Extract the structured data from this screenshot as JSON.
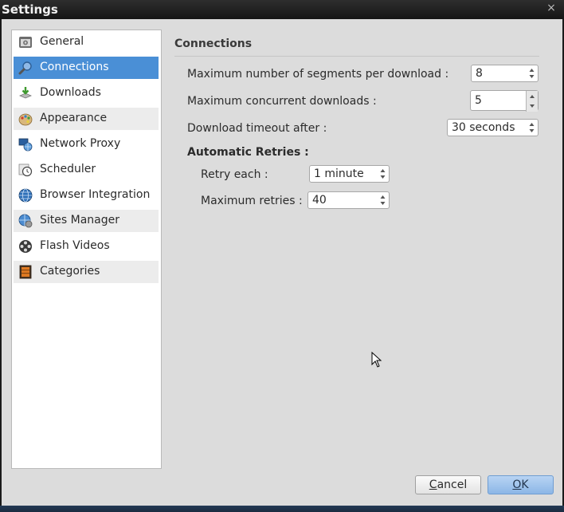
{
  "window": {
    "title": "Settings",
    "close_glyph": "×"
  },
  "sidebar": {
    "items": [
      {
        "label": "General",
        "icon": "general-icon"
      },
      {
        "label": "Connections",
        "icon": "connections-icon",
        "selected": true
      },
      {
        "label": "Downloads",
        "icon": "downloads-icon"
      },
      {
        "label": "Appearance",
        "icon": "appearance-icon"
      },
      {
        "label": "Network Proxy",
        "icon": "network-proxy-icon"
      },
      {
        "label": "Scheduler",
        "icon": "scheduler-icon"
      },
      {
        "label": "Browser Integration",
        "icon": "browser-integration-icon"
      },
      {
        "label": "Sites Manager",
        "icon": "sites-manager-icon"
      },
      {
        "label": "Flash Videos",
        "icon": "flash-videos-icon"
      },
      {
        "label": "Categories",
        "icon": "categories-icon"
      }
    ]
  },
  "connections": {
    "title": "Connections",
    "max_segments": {
      "label": "Maximum number of segments per download :",
      "value": "8"
    },
    "max_concurrent": {
      "label": "Maximum concurrent downloads :",
      "value": "5"
    },
    "timeout": {
      "label": "Download timeout after :",
      "value": "30 seconds"
    },
    "retries": {
      "title": "Automatic Retries :",
      "retry_each": {
        "label": "Retry each :",
        "value": "1 minute"
      },
      "max_retries": {
        "label": "Maximum retries :",
        "value": "40"
      }
    }
  },
  "buttons": {
    "cancel": {
      "mnemonic": "C",
      "rest": "ancel"
    },
    "ok": {
      "mnemonic": "O",
      "rest": "K"
    }
  },
  "colors": {
    "selection": "#4a8fd6",
    "titlebar": "#1f1f1f",
    "ok_button": "#9cc2ec"
  }
}
